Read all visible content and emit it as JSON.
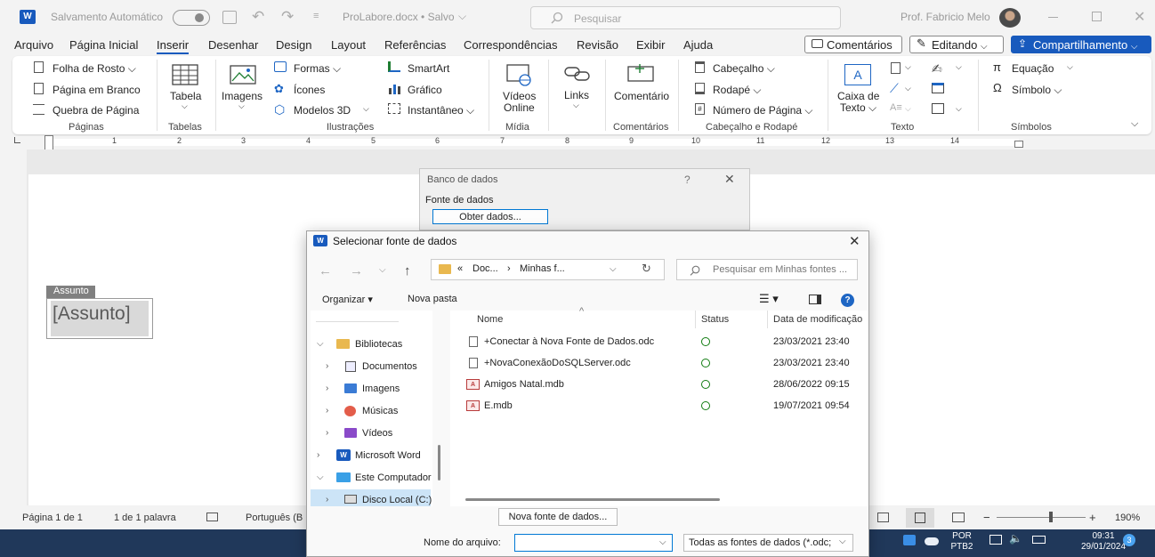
{
  "titlebar": {
    "autosave_label": "Salvamento Automático",
    "doc_name": "ProLabore.docx • Salvo",
    "search_placeholder": "Pesquisar",
    "user_name": "Prof. Fabricio Melo"
  },
  "menu": {
    "tabs": [
      "Arquivo",
      "Página Inicial",
      "Inserir",
      "Desenhar",
      "Design",
      "Layout",
      "Referências",
      "Correspondências",
      "Revisão",
      "Exibir",
      "Ajuda"
    ],
    "active": "Inserir",
    "comments_label": "Comentários",
    "editing_label": "Editando",
    "share_label": "Compartilhamento"
  },
  "ribbon": {
    "paginas": {
      "cover": "Folha de Rosto",
      "blank": "Página em Branco",
      "break": "Quebra de Página",
      "label": "Páginas"
    },
    "tabelas": {
      "table": "Tabela",
      "label": "Tabelas"
    },
    "ilustracoes": {
      "images": "Imagens",
      "shapes": "Formas",
      "icons": "Ícones",
      "models": "Modelos 3D",
      "smartart": "SmartArt",
      "chart": "Gráfico",
      "screenshot": "Instantâneo",
      "label": "Ilustrações"
    },
    "midia": {
      "videos_1": "Vídeos",
      "videos_2": "Online",
      "label": "Mídia"
    },
    "links": {
      "links": "Links"
    },
    "comentarios": {
      "comment": "Comentário",
      "label": "Comentários"
    },
    "cabecalho": {
      "header": "Cabeçalho",
      "footer": "Rodapé",
      "page_number": "Número de Página",
      "label": "Cabeçalho e Rodapé"
    },
    "texto": {
      "textbox_1": "Caixa de",
      "textbox_2": "Texto",
      "label": "Texto"
    },
    "simbolos": {
      "equation": "Equação",
      "symbol": "Símbolo",
      "label": "Símbolos"
    }
  },
  "ruler": [
    "1",
    "2",
    "3",
    "4",
    "5",
    "6",
    "7",
    "8",
    "9",
    "10",
    "11",
    "12",
    "13",
    "14"
  ],
  "document": {
    "field_tag": "Assunto",
    "field_value": "[Assunto]"
  },
  "status": {
    "page": "Página 1 de 1",
    "words": "1 de 1 palavra",
    "language": "Português (B",
    "zoom": "190%"
  },
  "taskbar": {
    "lang_1": "POR",
    "lang_2": "PTB2",
    "time": "09:31",
    "date": "29/01/2024",
    "badge": "3"
  },
  "banco": {
    "title": "Banco de dados",
    "help": "?",
    "section": "Fonte de dados",
    "button": "Obter dados..."
  },
  "dialog": {
    "title": "Selecionar fonte de dados",
    "address": {
      "prefix": "«",
      "part1": "Doc...",
      "sep": "›",
      "part2": "Minhas f..."
    },
    "search_placeholder": "Pesquisar em Minhas fontes ...",
    "organize": "Organizar",
    "new_folder": "Nova pasta",
    "tree": [
      {
        "label": "Bibliotecas",
        "expanded": true
      },
      {
        "label": "Documentos"
      },
      {
        "label": "Imagens"
      },
      {
        "label": "Músicas"
      },
      {
        "label": "Vídeos"
      },
      {
        "label": "Microsoft Word"
      },
      {
        "label": "Este Computador",
        "expanded": true
      },
      {
        "label": "Disco Local (C:)"
      }
    ],
    "columns": {
      "name": "Nome",
      "status": "Status",
      "date": "Data de modificação"
    },
    "files": [
      {
        "name": "+Conectar à Nova Fonte de Dados.odc",
        "date": "23/03/2021 23:40"
      },
      {
        "name": "+NovaConexãoDoSQLServer.odc",
        "date": "23/03/2021 23:40"
      },
      {
        "name": "Amigos Natal.mdb",
        "date": "28/06/2022 09:15"
      },
      {
        "name": "E.mdb",
        "date": "19/07/2021 09:54"
      }
    ],
    "new_source_button": "Nova fonte de dados...",
    "filename_label": "Nome do arquivo:",
    "filename_value": "",
    "filetype": "Todas as fontes de dados (*.odc;"
  },
  "colors": {
    "accent": "#185abd",
    "taskbar": "#20385a",
    "ok": "#107c10"
  }
}
